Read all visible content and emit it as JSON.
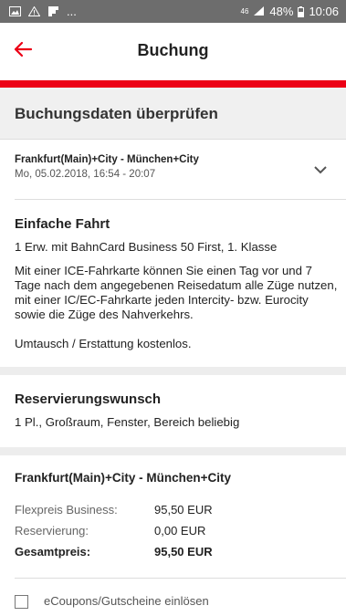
{
  "statusbar": {
    "network": "46",
    "battery": "48%",
    "time": "10:06",
    "dots": "..."
  },
  "appbar": {
    "title": "Buchung",
    "back_icon": "arrow-left-icon",
    "accent_color": "#ec0016"
  },
  "section": {
    "title": "Buchungsdaten überprüfen"
  },
  "trip": {
    "route": "Frankfurt(Main)+City - München+City",
    "datetime": "Mo, 05.02.2018, 16:54 - 20:07",
    "fare_title": "Einfache Fahrt",
    "passengers": "1 Erw. mit BahnCard Business 50 First, 1. Klasse",
    "conditions_1": "Mit einer ICE-Fahrkarte können Sie einen Tag vor und 7 Tage nach dem angegebenen Reisedatum alle Züge nutzen, mit einer IC/EC-Fahrkarte jeden Intercity- bzw. Eurocity sowie die Züge des Nahverkehrs.",
    "conditions_2": "Umtausch / Erstattung kostenlos."
  },
  "reservation": {
    "title": "Reservierungswunsch",
    "details": "1 Pl., Großraum, Fenster, Bereich beliebig"
  },
  "price": {
    "route": "Frankfurt(Main)+City - München+City",
    "rows": [
      {
        "label": "Flexpreis Business:",
        "value": "95,50 EUR"
      },
      {
        "label": "Reservierung:",
        "value": "0,00 EUR"
      },
      {
        "label": "Gesamtpreis:",
        "value": "95,50 EUR"
      }
    ],
    "coupon_label": "eCoupons/Gutscheine einlösen"
  }
}
